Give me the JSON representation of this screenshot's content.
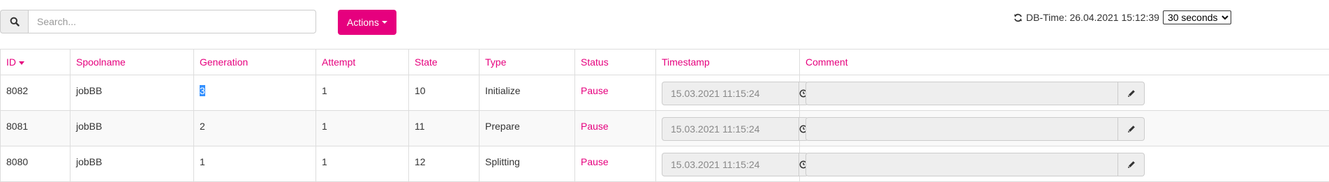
{
  "toolbar": {
    "search": {
      "placeholder": "Search...",
      "value": "",
      "icon": "search-icon"
    },
    "actions_label": "Actions",
    "db_time_label": "DB-Time: 26.04.2021 15:12:39",
    "refresh_icon": "refresh-icon",
    "interval": {
      "selected": "30 seconds"
    }
  },
  "table": {
    "columns": [
      "ID",
      "Spoolname",
      "Generation",
      "Attempt",
      "State",
      "Type",
      "Status",
      "Timestamp",
      "Comment"
    ],
    "sort": {
      "column": "ID",
      "direction": "descending"
    },
    "rows": [
      {
        "id": "8082",
        "spoolname": "jobBB",
        "generation": "3",
        "attempt": "1",
        "state": "10",
        "type": "Initialize",
        "status": "Pause",
        "timestamp": "15.03.2021 11:15:24",
        "comment": ""
      },
      {
        "id": "8081",
        "spoolname": "jobBB",
        "generation": "2",
        "attempt": "1",
        "state": "11",
        "type": "Prepare",
        "status": "Pause",
        "timestamp": "15.03.2021 11:15:24",
        "comment": ""
      },
      {
        "id": "8080",
        "spoolname": "jobBB",
        "generation": "1",
        "attempt": "1",
        "state": "12",
        "type": "Splitting",
        "status": "Pause",
        "timestamp": "15.03.2021 11:15:24",
        "comment": ""
      }
    ]
  },
  "colors": {
    "accent": "#e6007e",
    "header_text": "#e6007e",
    "selection": "#3390ff",
    "input_disabled_bg": "#eeeeee"
  }
}
